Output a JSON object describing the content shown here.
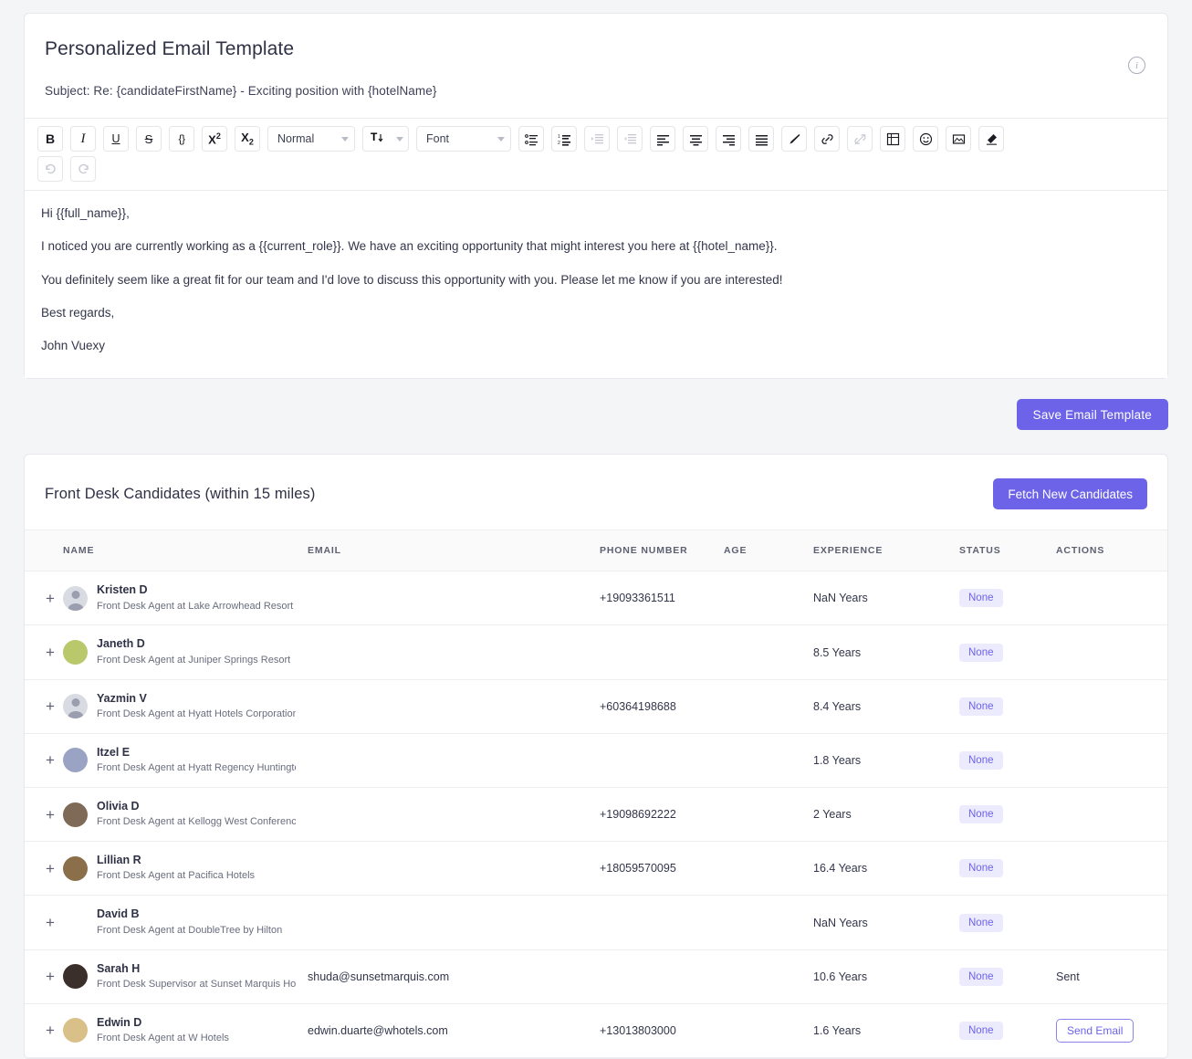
{
  "colors": {
    "accent": "#6c63e8",
    "badge_bg": "#eceafd",
    "badge_text": "#6c63e8",
    "page_bg": "#f4f5f7"
  },
  "email_template": {
    "title": "Personalized Email Template",
    "subject": "Subject: Re: {candidateFirstName} - Exciting position with {hotelName}",
    "info_icon": "info-circle-icon",
    "toolbar": {
      "row1": [
        {
          "name": "bold-button",
          "label": "B",
          "kind": "bold",
          "disabled": false
        },
        {
          "name": "italic-button",
          "label": "I",
          "kind": "italic",
          "disabled": false
        },
        {
          "name": "underline-button",
          "label": "U",
          "kind": "underline",
          "disabled": false
        },
        {
          "name": "strikethrough-button",
          "label": "S",
          "kind": "strike",
          "disabled": false
        },
        {
          "name": "code-block-button",
          "label": "{}",
          "kind": "code",
          "disabled": false
        },
        {
          "name": "superscript-button",
          "label": "X2",
          "kind": "sup",
          "disabled": false
        },
        {
          "name": "subscript-button",
          "label": "X2",
          "kind": "sub",
          "disabled": false
        }
      ],
      "heading_select": "Normal",
      "font_size_icon": "font-size-icon",
      "font_select": "Font",
      "icon_buttons": [
        {
          "name": "bullet-list-button",
          "icon": "bullet-list-icon",
          "disabled": false
        },
        {
          "name": "numbered-list-button",
          "icon": "numbered-list-icon",
          "disabled": false
        },
        {
          "name": "indent-button",
          "icon": "indent-increase-icon",
          "disabled": true
        },
        {
          "name": "outdent-button",
          "icon": "indent-decrease-icon",
          "disabled": true
        },
        {
          "name": "align-left-button",
          "icon": "align-left-icon",
          "disabled": false
        },
        {
          "name": "align-center-button",
          "icon": "align-center-icon",
          "disabled": false
        },
        {
          "name": "align-right-button",
          "icon": "align-right-icon",
          "disabled": false
        },
        {
          "name": "align-justify-button",
          "icon": "align-justify-icon",
          "disabled": false
        },
        {
          "name": "text-color-button",
          "icon": "pen-icon",
          "disabled": false
        },
        {
          "name": "insert-link-button",
          "icon": "link-icon",
          "disabled": false
        },
        {
          "name": "remove-link-button",
          "icon": "unlink-icon",
          "disabled": true
        },
        {
          "name": "insert-table-button",
          "icon": "table-icon",
          "disabled": false
        },
        {
          "name": "emoji-button",
          "icon": "smiley-icon",
          "disabled": false
        },
        {
          "name": "insert-image-button",
          "icon": "image-icon",
          "disabled": false
        },
        {
          "name": "clear-format-button",
          "icon": "eraser-icon",
          "disabled": false
        }
      ],
      "row2": [
        {
          "name": "undo-button",
          "icon": "undo-icon",
          "disabled": true
        },
        {
          "name": "redo-button",
          "icon": "redo-icon",
          "disabled": true
        }
      ]
    },
    "body_paragraphs": [
      "Hi {{full_name}},",
      "I noticed you are currently working as a {{current_role}}. We have an exciting opportunity that might interest you here at {{hotel_name}}.",
      "You definitely seem like a great fit for our team and I'd love to discuss this opportunity with you. Please let me know if you are interested!",
      "Best regards,",
      "John Vuexy"
    ],
    "save_label": "Save Email Template"
  },
  "candidates_section": {
    "title": "Front Desk Candidates (within 15 miles)",
    "fetch_label": "Fetch New Candidates",
    "columns": [
      "",
      "NAME",
      "EMAIL",
      "PHONE NUMBER",
      "AGE",
      "EXPERIENCE",
      "STATUS",
      "ACTIONS"
    ],
    "expand_glyph": "+",
    "rows": [
      {
        "name": "Kristen D",
        "role": "Front Desk Agent at Lake Arrowhead Resort an",
        "email": "",
        "phone": "+19093361511",
        "age": "",
        "experience": "NaN Years",
        "status": "None",
        "action": "",
        "avatar": "placeholder",
        "avatar_color": "#d9dbe3"
      },
      {
        "name": "Janeth D",
        "role": "Front Desk Agent at Juniper Springs Resort",
        "email": "",
        "phone": "",
        "age": "",
        "experience": "8.5 Years",
        "status": "None",
        "action": "",
        "avatar": "photo",
        "avatar_color": "#b9c86a"
      },
      {
        "name": "Yazmin V",
        "role": "Front Desk Agent at Hyatt Hotels Corporation",
        "email": "",
        "phone": "+60364198688",
        "age": "",
        "experience": "8.4 Years",
        "status": "None",
        "action": "",
        "avatar": "placeholder",
        "avatar_color": "#d9dbe3"
      },
      {
        "name": "Itzel E",
        "role": "Front Desk Agent at Hyatt Regency Huntington",
        "email": "",
        "phone": "",
        "age": "",
        "experience": "1.8 Years",
        "status": "None",
        "action": "",
        "avatar": "photo",
        "avatar_color": "#9aa3c4"
      },
      {
        "name": "Olivia D",
        "role": "Front Desk Agent at Kellogg West Conference C",
        "email": "",
        "phone": "+19098692222",
        "age": "",
        "experience": "2 Years",
        "status": "None",
        "action": "",
        "avatar": "photo",
        "avatar_color": "#7e6a56"
      },
      {
        "name": "Lillian R",
        "role": "Front Desk Agent at Pacifica Hotels",
        "email": "",
        "phone": "+18059570095",
        "age": "",
        "experience": "16.4 Years",
        "status": "None",
        "action": "",
        "avatar": "photo",
        "avatar_color": "#8a6f4a"
      },
      {
        "name": "David B",
        "role": "Front Desk Agent at DoubleTree by Hilton",
        "email": "",
        "phone": "",
        "age": "",
        "experience": "NaN Years",
        "status": "None",
        "action": "",
        "avatar": "none",
        "avatar_color": "transparent"
      },
      {
        "name": "Sarah H",
        "role": "Front Desk Supervisor at Sunset Marquis Hotel",
        "email": "shuda@sunsetmarquis.com",
        "phone": "",
        "age": "",
        "experience": "10.6 Years",
        "status": "None",
        "action": "Sent",
        "action_type": "text",
        "avatar": "photo",
        "avatar_color": "#3b2f2b"
      },
      {
        "name": "Edwin D",
        "role": "Front Desk Agent at W Hotels",
        "email": "edwin.duarte@whotels.com",
        "phone": "+13013803000",
        "age": "",
        "experience": "1.6 Years",
        "status": "None",
        "action": "Send Email",
        "action_type": "button",
        "avatar": "photo",
        "avatar_color": "#d9c089"
      }
    ]
  }
}
